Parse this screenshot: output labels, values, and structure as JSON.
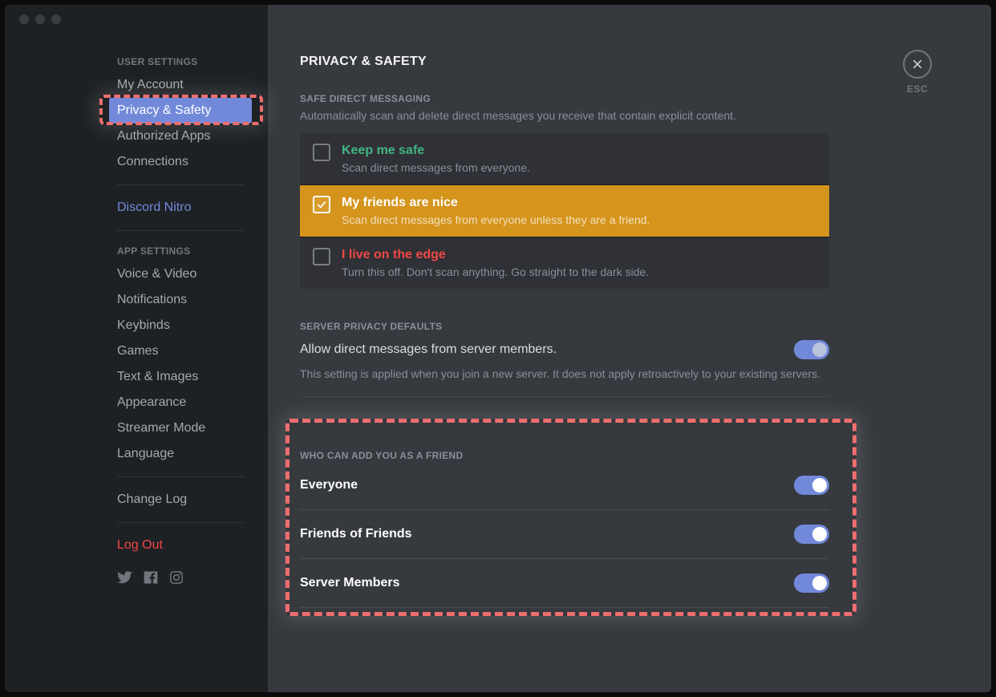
{
  "sidebar": {
    "user_settings_header": "USER SETTINGS",
    "items_top": [
      {
        "label": "My Account"
      },
      {
        "label": "Privacy & Safety"
      },
      {
        "label": "Authorized Apps"
      },
      {
        "label": "Connections"
      }
    ],
    "nitro_label": "Discord Nitro",
    "app_settings_header": "APP SETTINGS",
    "items_app": [
      {
        "label": "Voice & Video"
      },
      {
        "label": "Notifications"
      },
      {
        "label": "Keybinds"
      },
      {
        "label": "Games"
      },
      {
        "label": "Text & Images"
      },
      {
        "label": "Appearance"
      },
      {
        "label": "Streamer Mode"
      },
      {
        "label": "Language"
      }
    ],
    "changelog_label": "Change Log",
    "logout_label": "Log Out"
  },
  "page": {
    "title": "PRIVACY & SAFETY",
    "safe_dm": {
      "header": "SAFE DIRECT MESSAGING",
      "subtitle": "Automatically scan and delete direct messages you receive that contain explicit content.",
      "options": [
        {
          "title": "Keep me safe",
          "desc": "Scan direct messages from everyone."
        },
        {
          "title": "My friends are nice",
          "desc": "Scan direct messages from everyone unless they are a friend."
        },
        {
          "title": "I live on the edge",
          "desc": "Turn this off. Don't scan anything. Go straight to the dark side."
        }
      ]
    },
    "server_privacy": {
      "header": "SERVER PRIVACY DEFAULTS",
      "toggle_label": "Allow direct messages from server members.",
      "note": "This setting is applied when you join a new server. It does not apply retroactively to your existing servers."
    },
    "friend_add": {
      "header": "WHO CAN ADD YOU AS A FRIEND",
      "rows": [
        {
          "label": "Everyone"
        },
        {
          "label": "Friends of Friends"
        },
        {
          "label": "Server Members"
        }
      ]
    }
  },
  "esc_label": "ESC"
}
